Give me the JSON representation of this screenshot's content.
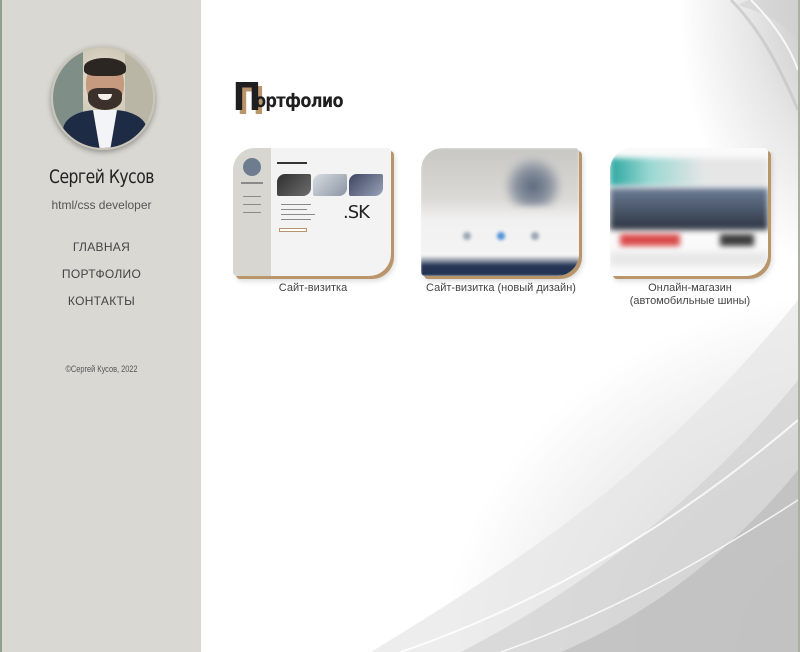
{
  "sidebar": {
    "name": "Сергей Кусов",
    "role": "html/css developer",
    "nav": [
      {
        "label": "ГЛАВНАЯ"
      },
      {
        "label": "ПОРТФОЛИО"
      },
      {
        "label": "КОНТАКТЫ"
      }
    ],
    "copyright": "©Сергей Кусов, 2022"
  },
  "main": {
    "title_first_letter": "П",
    "title_rest": "ортфолио",
    "portfolio": [
      {
        "caption": "Сайт-визитка"
      },
      {
        "caption": "Сайт-визитка (новый дизайн)"
      },
      {
        "caption_line1": "Онлайн-магазин",
        "caption_line2": "(автомобильные шины)"
      }
    ],
    "thumb1_logo": ".SK"
  },
  "colors": {
    "sidebar_bg": "#d9d8d3",
    "accent_gold": "#b8956a",
    "frame_green": "#8fa08d"
  }
}
